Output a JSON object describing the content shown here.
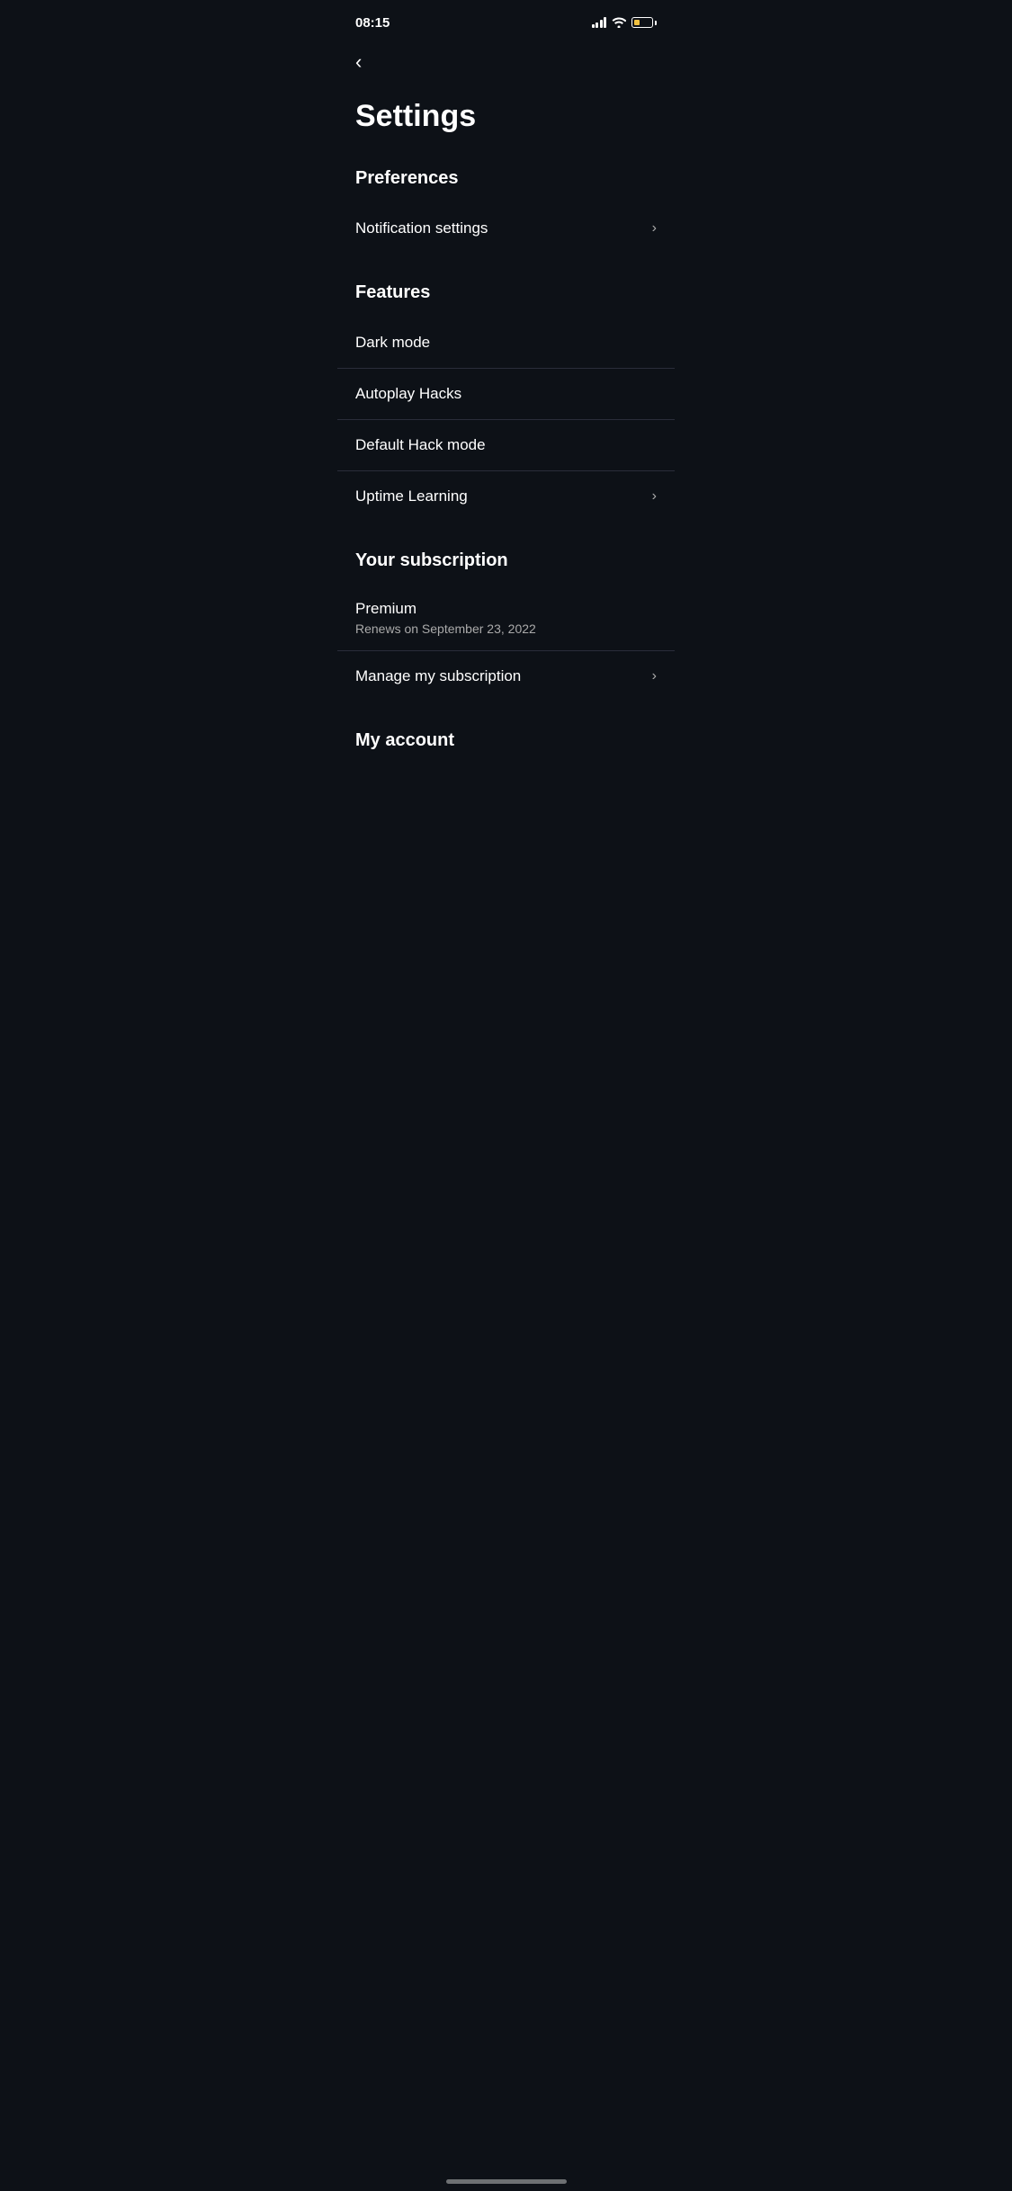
{
  "statusBar": {
    "time": "08:15"
  },
  "nav": {
    "backLabel": "‹"
  },
  "page": {
    "title": "Settings"
  },
  "preferences": {
    "sectionLabel": "Preferences",
    "items": [
      {
        "label": "Notification settings",
        "hasChevron": true
      }
    ]
  },
  "features": {
    "sectionLabel": "Features",
    "items": [
      {
        "label": "Dark mode",
        "hasChevron": false
      },
      {
        "label": "Autoplay Hacks",
        "hasChevron": false
      },
      {
        "label": "Default Hack mode",
        "hasChevron": false
      },
      {
        "label": "Uptime Learning",
        "hasChevron": true
      }
    ]
  },
  "subscription": {
    "sectionLabel": "Your subscription",
    "name": "Premium",
    "renewText": "Renews on September 23, 2022",
    "manageLabel": "Manage my subscription"
  },
  "myAccount": {
    "sectionLabel": "My account"
  },
  "chevron": "›"
}
